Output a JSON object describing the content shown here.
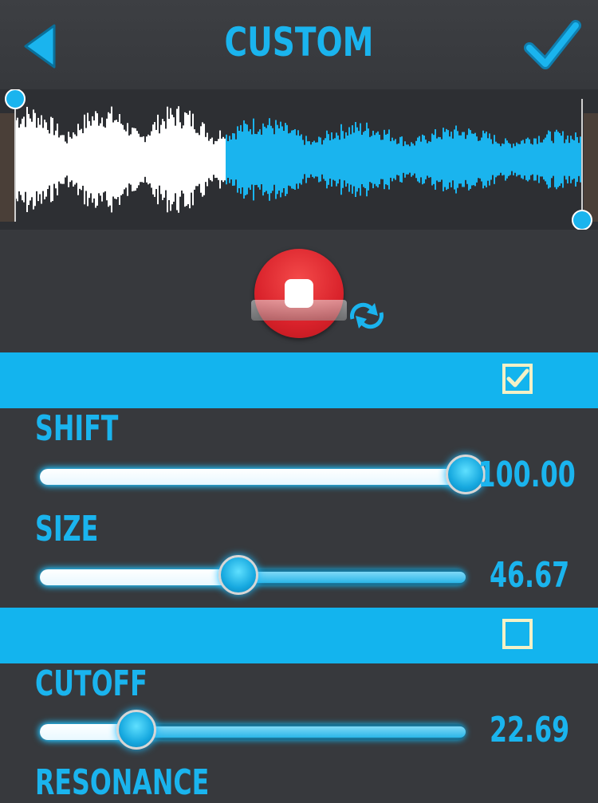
{
  "header": {
    "title": "CUSTOM",
    "back_icon": "back-arrow-icon",
    "confirm_icon": "checkmark-icon"
  },
  "colors": {
    "accent": "#1ab4ee",
    "background": "#37393d",
    "stop_button": "#dd2a30",
    "checkbox_border": "#f4f1c6"
  },
  "player": {
    "stop_icon": "stop-icon",
    "loop_icon": "loop-icon",
    "played_fraction": 0.37
  },
  "sections": [
    {
      "enabled": true,
      "params": [
        {
          "label": "SHIFT",
          "value": "100.00",
          "fraction": 1.0
        },
        {
          "label": "SIZE",
          "value": "46.67",
          "fraction": 0.4667
        }
      ]
    },
    {
      "enabled": false,
      "params": [
        {
          "label": "CUTOFF",
          "value": "22.69",
          "fraction": 0.2269
        },
        {
          "label": "RESONANCE"
        }
      ]
    }
  ]
}
